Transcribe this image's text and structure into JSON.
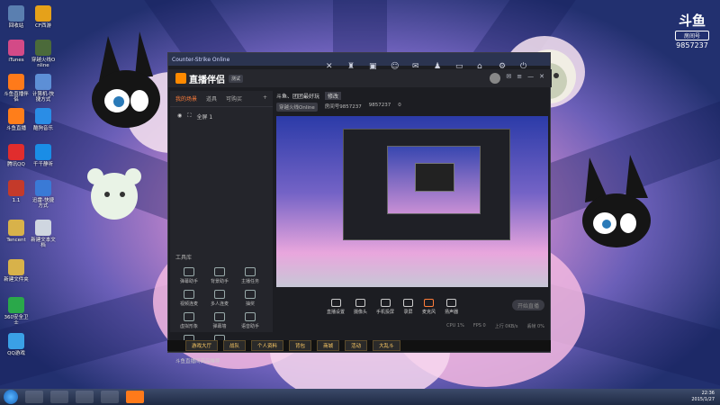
{
  "desktop": {
    "icons": [
      {
        "label": "回收站",
        "color": "#5a7fb0"
      },
      {
        "label": "CF西游",
        "color": "#e5a11a"
      },
      {
        "label": "iTunes",
        "color": "#d34a87"
      },
      {
        "label": "穿越火线Online",
        "color": "#4b6a3a"
      },
      {
        "label": "斗鱼直播伴侣",
        "color": "#ff7a1a"
      },
      {
        "label": "计算机-快捷方式",
        "color": "#5d8fd6"
      },
      {
        "label": "斗鱼直播",
        "color": "#ff7e1a"
      },
      {
        "label": "酷狗音乐",
        "color": "#2a8de6"
      },
      {
        "label": "腾讯QQ",
        "color": "#e12d2d"
      },
      {
        "label": "千千静听",
        "color": "#1a8de6"
      },
      {
        "label": "1.1",
        "color": "#c43a2a"
      },
      {
        "label": "迅雷-快捷方式",
        "color": "#3a7ad6"
      },
      {
        "label": "Tencent",
        "color": "#d8b24a"
      },
      {
        "label": "新建文本文档",
        "color": "#cfd6e0"
      },
      {
        "label": "新建文件夹",
        "color": "#d8b24a"
      },
      {
        "label": "360安全卫士",
        "color": "#2aa84a"
      },
      {
        "label": "QQ游戏",
        "color": "#3aa0e6"
      }
    ]
  },
  "watermark": {
    "brand": "斗鱼",
    "room_label": "房间号",
    "room_number": "9857237"
  },
  "window": {
    "title": "Counter-Strike Online",
    "app_name": "直播伴侣",
    "version_badge": "测试",
    "tabs": [
      "我的场景",
      "道具",
      "可购买"
    ],
    "scene_name": "全屏 1",
    "tools_heading": "工具库",
    "tools": [
      "弹幕助手",
      "背景助手",
      "主播任务",
      "视频连麦",
      "多人连麦",
      "抽奖",
      "虚拟形象",
      "弹幕墙",
      "语音助手",
      "投屏",
      "更多",
      ""
    ],
    "bottom_note": "斗鱼直播间商品推荐",
    "room_title": "斗鱼、团团最好玩",
    "room_tag": "修改",
    "room_category": "穿越火线Online",
    "room_id": "房间号9857237",
    "fans": "9857237",
    "hot": "0",
    "controls": [
      "直播设置",
      "摄像头",
      "手机投屏",
      "录屏",
      "麦克风",
      "扬声器"
    ],
    "live_button": "开始直播",
    "status": [
      "CPU 1%",
      "FPS 0",
      "上行 0KB/s",
      "丢帧 0%"
    ]
  },
  "game_buttons": [
    "游戏大厅",
    "战队",
    "个人资料",
    "背包",
    "商城",
    "活动",
    "大乱斗"
  ],
  "taskbar": {
    "time": "22:36",
    "date": "2015/1/27"
  }
}
